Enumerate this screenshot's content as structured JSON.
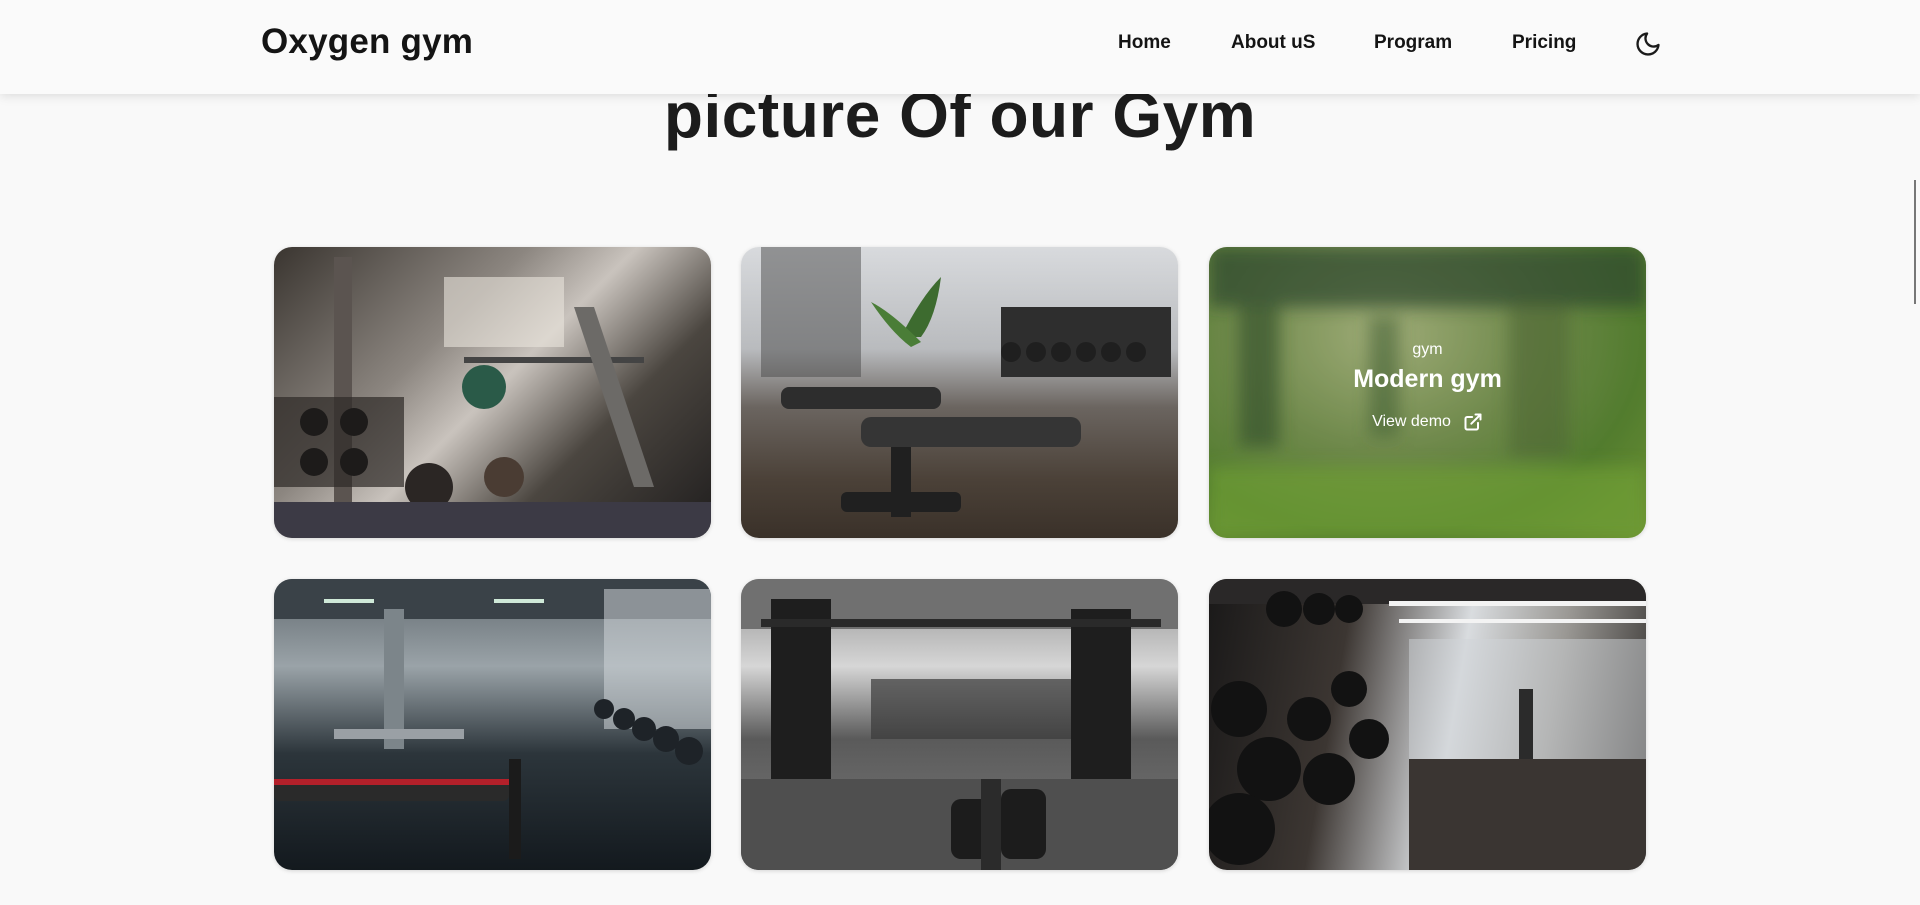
{
  "header": {
    "logo": "Oxygen gym",
    "nav": [
      "Home",
      "About uS",
      "Program",
      "Pricing"
    ],
    "theme_icon": "moon-icon"
  },
  "section": {
    "title": "picture Of our Gym"
  },
  "gallery": {
    "items": [
      {
        "id": 1,
        "image": "gym-weight-room-photo"
      },
      {
        "id": 2,
        "image": "gym-benches-dumbbells-photo"
      },
      {
        "id": 3,
        "image": "gym-blurred-photo",
        "category": "gym",
        "title": "Modern gym",
        "link_label": "View demo",
        "link_icon": "external-link-icon"
      },
      {
        "id": 4,
        "image": "gym-dark-hall-photo"
      },
      {
        "id": 5,
        "image": "gym-cable-machines-photo"
      },
      {
        "id": 6,
        "image": "gym-dumbbell-rack-photo"
      }
    ]
  },
  "colors": {
    "background": "#f9f9f9",
    "text": "#141414",
    "overlay_text": "#ffffff"
  }
}
